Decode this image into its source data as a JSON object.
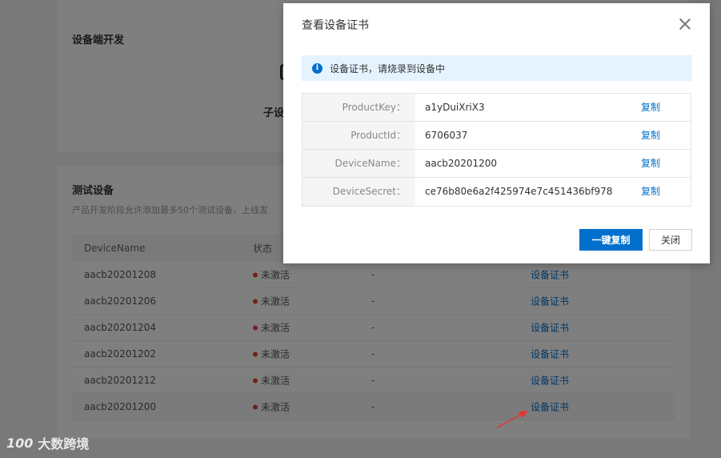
{
  "background": {
    "device_dev": {
      "title": "设备端开发",
      "subtitle_fragment": "子设"
    },
    "test_devices": {
      "title": "测试设备",
      "description_fragment": "产品开发阶段允许添加最多50个测试设备，上线发",
      "columns": {
        "device_name": "DeviceName",
        "status": "状态"
      },
      "rows": [
        {
          "name": "aacb20201208",
          "status": "未激活",
          "last": "-",
          "action": "设备证书"
        },
        {
          "name": "aacb20201206",
          "status": "未激活",
          "last": "-",
          "action": "设备证书"
        },
        {
          "name": "aacb20201204",
          "status": "未激活",
          "last": "-",
          "action": "设备证书"
        },
        {
          "name": "aacb20201202",
          "status": "未激活",
          "last": "-",
          "action": "设备证书"
        },
        {
          "name": "aacb20201212",
          "status": "未激活",
          "last": "-",
          "action": "设备证书"
        },
        {
          "name": "aacb20201200",
          "status": "未激活",
          "last": "-",
          "action": "设备证书"
        }
      ]
    }
  },
  "dialog": {
    "title": "查看设备证书",
    "notice": "设备证书，请烧录到设备中",
    "fields": [
      {
        "label": "ProductKey：",
        "value": "a1yDuiXriX3",
        "copy": "复制"
      },
      {
        "label": "ProductId：",
        "value": "6706037",
        "copy": "复制"
      },
      {
        "label": "DeviceName：",
        "value": "aacb20201200",
        "copy": "复制"
      },
      {
        "label": "DeviceSecret：",
        "value": "ce76b80e6a2f425974e7c451436bf978",
        "copy": "复制"
      }
    ],
    "copy_all_label": "一键复制",
    "close_label": "关闭"
  },
  "watermark": {
    "logo": "100",
    "text": "大数跨境"
  },
  "colors": {
    "primary": "#0070cc",
    "status_inactive": "#e2422f",
    "notice_bg": "#e5f3ff",
    "annotation_arrow": "#e8332a"
  }
}
